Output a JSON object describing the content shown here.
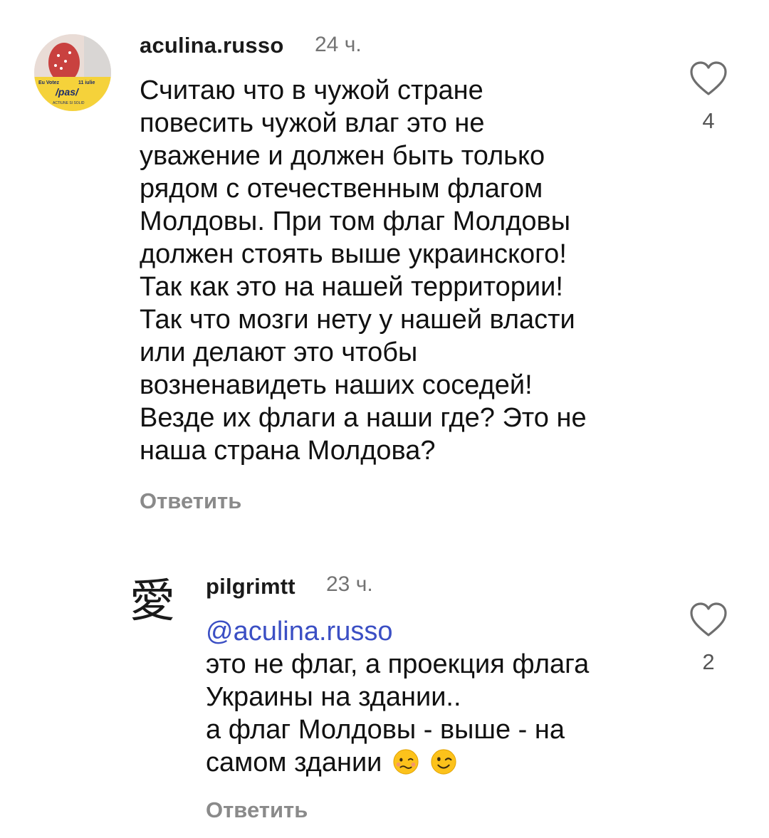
{
  "comments": [
    {
      "username": "aculina.russo",
      "timestamp": "24 ч.",
      "avatar": {
        "description_text": [
          "Eu Votez",
          "11 iulie",
          "/pas/",
          "ACTIUNE SI SOLID"
        ],
        "accent_color": "#f5d23a"
      },
      "lines": [
        "Считаю что в чужой стране",
        "повесить чужой влаг это не",
        "уважение и должен быть только",
        "рядом с отечественным флагом",
        "Молдовы. При том флаг Молдовы",
        "должен стоять выше украинского!",
        "Так как это на нашей территории!",
        "Так что мозги нету у нашей власти",
        "или делают это чтобы",
        "возненавидеть наших соседей!",
        "Везде их флаги а наши где? Это не",
        "наша страна Молдова?"
      ],
      "reply_label": "Ответить",
      "like_count": "4",
      "like_icon": "heart-outline-icon"
    },
    {
      "username": "pilgrimtt",
      "timestamp": "23 ч.",
      "avatar": {
        "glyph": "愛"
      },
      "mention": "@aculina.russo",
      "lines": [
        "это не флаг, а проекция флага",
        "Украины на здании..",
        "а флаг Молдовы - выше - на",
        "самом здании"
      ],
      "emojis": [
        "woozy-face-icon",
        "winking-face-icon"
      ],
      "reply_label": "Ответить",
      "like_count": "2",
      "like_icon": "heart-outline-icon"
    }
  ],
  "colors": {
    "mention": "#3b4fc4",
    "secondary_text": "#737373",
    "reply_text": "#8a8a8a"
  }
}
